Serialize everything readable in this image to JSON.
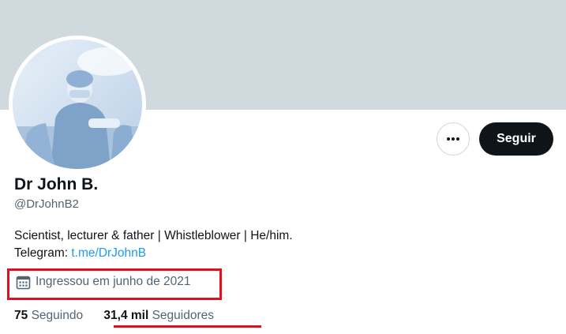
{
  "profile": {
    "display_name": "Dr John B.",
    "handle": "@DrJohnB2",
    "bio_line1": "Scientist, lecturer & father | Whistleblower | He/him.",
    "bio_line2_prefix": "Telegram: ",
    "bio_link": "t.me/DrJohnB",
    "joined": "Ingressou em junho de 2021"
  },
  "actions": {
    "follow_label": "Seguir",
    "more_icon": "more-icon"
  },
  "stats": {
    "following_count": "75",
    "following_label": "Seguindo",
    "followers_count": "31,4 mil",
    "followers_label": "Seguidores"
  },
  "colors": {
    "banner": "#cfd9de",
    "link": "#1d9bf0",
    "follow_button": "#0f1419",
    "annotation": "#e0101f",
    "secondary_text": "#536471"
  }
}
